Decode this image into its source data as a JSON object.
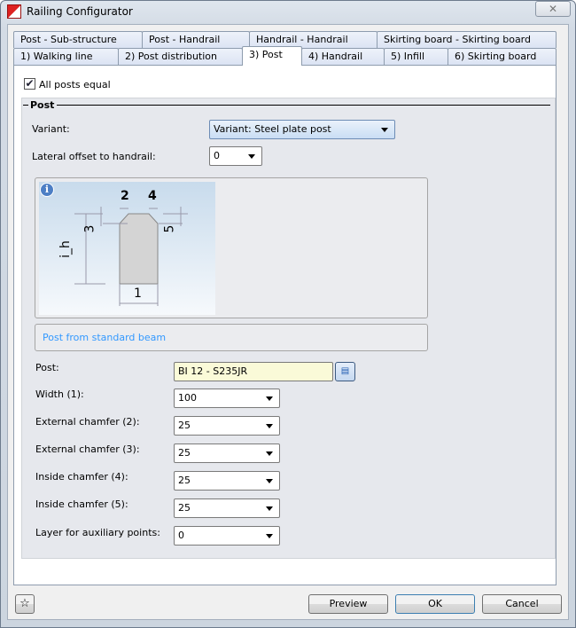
{
  "window": {
    "title": "Railing Configurator",
    "close_glyph": "✕"
  },
  "tabs_row1": [
    "Post - Sub-structure",
    "Post - Handrail",
    "Handrail - Handrail",
    "Skirting board - Skirting board"
  ],
  "tabs_row2": [
    "1) Walking line",
    "2) Post distribution",
    "3) Post",
    "4) Handrail",
    "5) Infill",
    "6) Skirting board"
  ],
  "all_posts_equal": {
    "label": "All posts equal",
    "checked": true
  },
  "group": {
    "title": "Post"
  },
  "variant": {
    "label": "Variant:",
    "value": "Variant: Steel plate post"
  },
  "lateral_offset": {
    "label": "Lateral offset to handrail:",
    "value": "0"
  },
  "diagram": {
    "labels": [
      "2",
      "4",
      "3",
      "5",
      "i_h",
      "1"
    ]
  },
  "standard_beam": {
    "label": "Post from standard beam"
  },
  "post": {
    "label": "Post:",
    "value": "BI 12 - S235JR"
  },
  "fields": [
    {
      "label": "Width (1):",
      "value": "100"
    },
    {
      "label": "External chamfer (2):",
      "value": "25"
    },
    {
      "label": "External chamfer (3):",
      "value": "25"
    },
    {
      "label": "Inside chamfer (4):",
      "value": "25"
    },
    {
      "label": "Inside chamfer (5):",
      "value": "25"
    },
    {
      "label": "Layer for auxiliary points:",
      "value": "0"
    }
  ],
  "buttons": {
    "preview": "Preview",
    "ok": "OK",
    "cancel": "Cancel"
  }
}
